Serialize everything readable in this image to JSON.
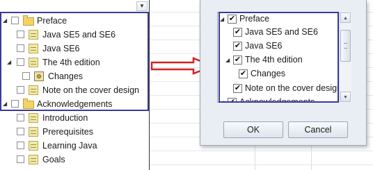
{
  "tree": {
    "rows": [
      {
        "label": "Preface",
        "level": 0,
        "expander": "expanded",
        "icon": "folder-icon"
      },
      {
        "label": "Java SE5 and SE6",
        "level": 1,
        "expander": "none",
        "icon": "document-icon"
      },
      {
        "label": "Java SE6",
        "level": 1,
        "expander": "none",
        "icon": "document-icon"
      },
      {
        "label": "The 4th edition",
        "level": 1,
        "expander": "expanded",
        "icon": "document-icon"
      },
      {
        "label": "Changes",
        "level": 2,
        "expander": "none",
        "icon": "certificate-icon"
      },
      {
        "label": "Note on the cover design",
        "level": 1,
        "expander": "none",
        "icon": "document-icon"
      },
      {
        "label": "Acknowledgements",
        "level": 0,
        "expander": "expanded",
        "icon": "folder-icon"
      },
      {
        "label": "Introduction",
        "level": 1,
        "expander": "none",
        "icon": "document-icon"
      },
      {
        "label": "Prerequisites",
        "level": 1,
        "expander": "none",
        "icon": "document-icon"
      },
      {
        "label": "Learning Java",
        "level": 1,
        "expander": "none",
        "icon": "document-icon"
      },
      {
        "label": "Goals",
        "level": 1,
        "expander": "none",
        "icon": "document-icon"
      }
    ]
  },
  "dialog": {
    "items": [
      {
        "label": "Preface",
        "checked": true
      },
      {
        "label": "Java SE5 and SE6",
        "checked": true
      },
      {
        "label": "Java SE6",
        "checked": true
      },
      {
        "label": "The 4th edition",
        "checked": true
      },
      {
        "label": "Changes",
        "checked": true
      },
      {
        "label": "Note on the cover design",
        "checked": true
      },
      {
        "label": "Acknowledgements",
        "checked": true
      }
    ],
    "ok_label": "OK",
    "cancel_label": "Cancel"
  },
  "colors": {
    "highlight_border": "#3a3a9c",
    "arrow": "#d42020"
  }
}
